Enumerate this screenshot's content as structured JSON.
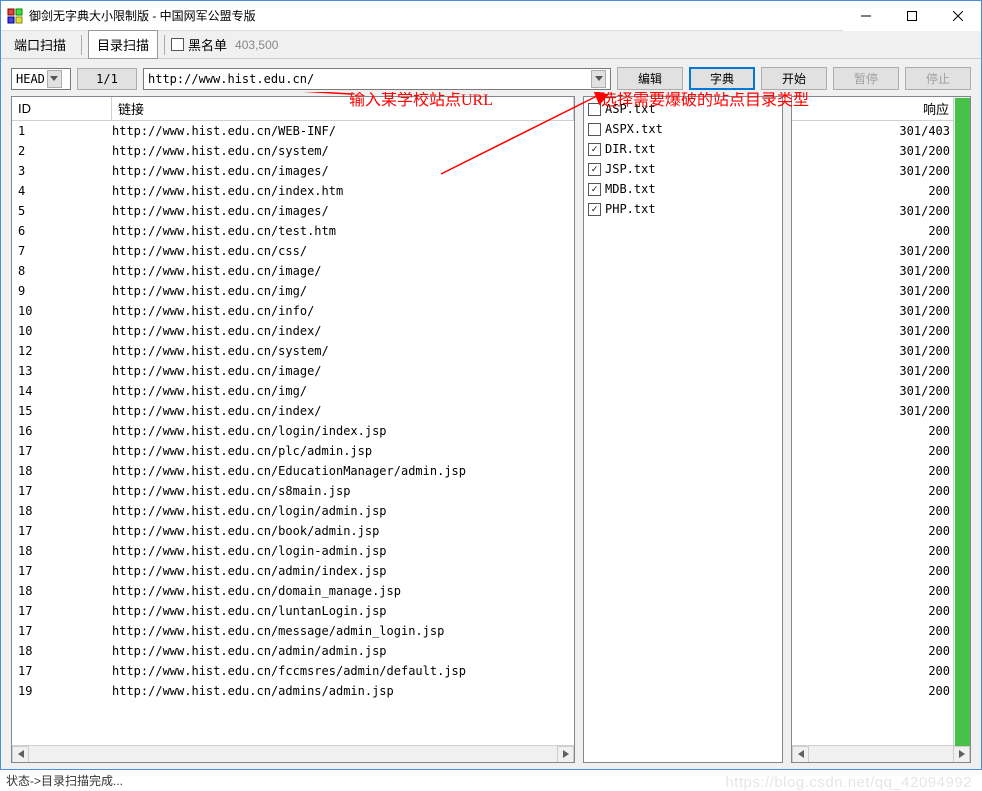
{
  "window": {
    "title": "御剑无字典大小限制版 - 中国网军公盟专版"
  },
  "menu": {
    "tab1": "端口扫描",
    "tab2": "目录扫描",
    "blacklist_label": "黑名单",
    "blacklist_value": "403,500"
  },
  "toolbar": {
    "method": "HEAD",
    "page": "1/1",
    "url": "http://www.hist.edu.cn/",
    "btn_edit": "编辑",
    "btn_dict": "字典",
    "btn_start": "开始",
    "btn_pause": "暂停",
    "btn_stop": "停止"
  },
  "annotations": {
    "a1": "输入某学校站点URL",
    "a2": "选择需要爆破的站点目录类型"
  },
  "table": {
    "header_id": "ID",
    "header_url": "链接",
    "header_resp": "响应",
    "rows": [
      {
        "id": "1",
        "url": "http://www.hist.edu.cn/WEB-INF/",
        "resp": "301/403"
      },
      {
        "id": "2",
        "url": "http://www.hist.edu.cn/system/",
        "resp": "301/200"
      },
      {
        "id": "3",
        "url": "http://www.hist.edu.cn/images/",
        "resp": "301/200"
      },
      {
        "id": "4",
        "url": "http://www.hist.edu.cn/index.htm",
        "resp": "200"
      },
      {
        "id": "5",
        "url": "http://www.hist.edu.cn/images/",
        "resp": "301/200"
      },
      {
        "id": "6",
        "url": "http://www.hist.edu.cn/test.htm",
        "resp": "200"
      },
      {
        "id": "7",
        "url": "http://www.hist.edu.cn/css/",
        "resp": "301/200"
      },
      {
        "id": "8",
        "url": "http://www.hist.edu.cn/image/",
        "resp": "301/200"
      },
      {
        "id": "9",
        "url": "http://www.hist.edu.cn/img/",
        "resp": "301/200"
      },
      {
        "id": "10",
        "url": "http://www.hist.edu.cn/info/",
        "resp": "301/200"
      },
      {
        "id": "10",
        "url": "http://www.hist.edu.cn/index/",
        "resp": "301/200"
      },
      {
        "id": "12",
        "url": "http://www.hist.edu.cn/system/",
        "resp": "301/200"
      },
      {
        "id": "13",
        "url": "http://www.hist.edu.cn/image/",
        "resp": "301/200"
      },
      {
        "id": "14",
        "url": "http://www.hist.edu.cn/img/",
        "resp": "301/200"
      },
      {
        "id": "15",
        "url": "http://www.hist.edu.cn/index/",
        "resp": "301/200"
      },
      {
        "id": "16",
        "url": "http://www.hist.edu.cn/login/index.jsp",
        "resp": "200"
      },
      {
        "id": "17",
        "url": "http://www.hist.edu.cn/plc/admin.jsp",
        "resp": "200"
      },
      {
        "id": "18",
        "url": "http://www.hist.edu.cn/EducationManager/admin.jsp",
        "resp": "200"
      },
      {
        "id": "17",
        "url": "http://www.hist.edu.cn/s8main.jsp",
        "resp": "200"
      },
      {
        "id": "18",
        "url": "http://www.hist.edu.cn/login/admin.jsp",
        "resp": "200"
      },
      {
        "id": "17",
        "url": "http://www.hist.edu.cn/book/admin.jsp",
        "resp": "200"
      },
      {
        "id": "18",
        "url": "http://www.hist.edu.cn/login-admin.jsp",
        "resp": "200"
      },
      {
        "id": "17",
        "url": "http://www.hist.edu.cn/admin/index.jsp",
        "resp": "200"
      },
      {
        "id": "18",
        "url": "http://www.hist.edu.cn/domain_manage.jsp",
        "resp": "200"
      },
      {
        "id": "17",
        "url": "http://www.hist.edu.cn/luntanLogin.jsp",
        "resp": "200"
      },
      {
        "id": "17",
        "url": "http://www.hist.edu.cn/message/admin_login.jsp",
        "resp": "200"
      },
      {
        "id": "18",
        "url": "http://www.hist.edu.cn/admin/admin.jsp",
        "resp": "200"
      },
      {
        "id": "17",
        "url": "http://www.hist.edu.cn/fccmsres/admin/default.jsp",
        "resp": "200"
      },
      {
        "id": "19",
        "url": "http://www.hist.edu.cn/admins/admin.jsp",
        "resp": "200"
      }
    ]
  },
  "dicts": [
    {
      "name": "ASP.txt",
      "checked": false
    },
    {
      "name": "ASPX.txt",
      "checked": false
    },
    {
      "name": "DIR.txt",
      "checked": true
    },
    {
      "name": "JSP.txt",
      "checked": true
    },
    {
      "name": "MDB.txt",
      "checked": true
    },
    {
      "name": "PHP.txt",
      "checked": true
    }
  ],
  "status": "状态->目录扫描完成...",
  "watermark": "https://blog.csdn.net/qq_42094992"
}
